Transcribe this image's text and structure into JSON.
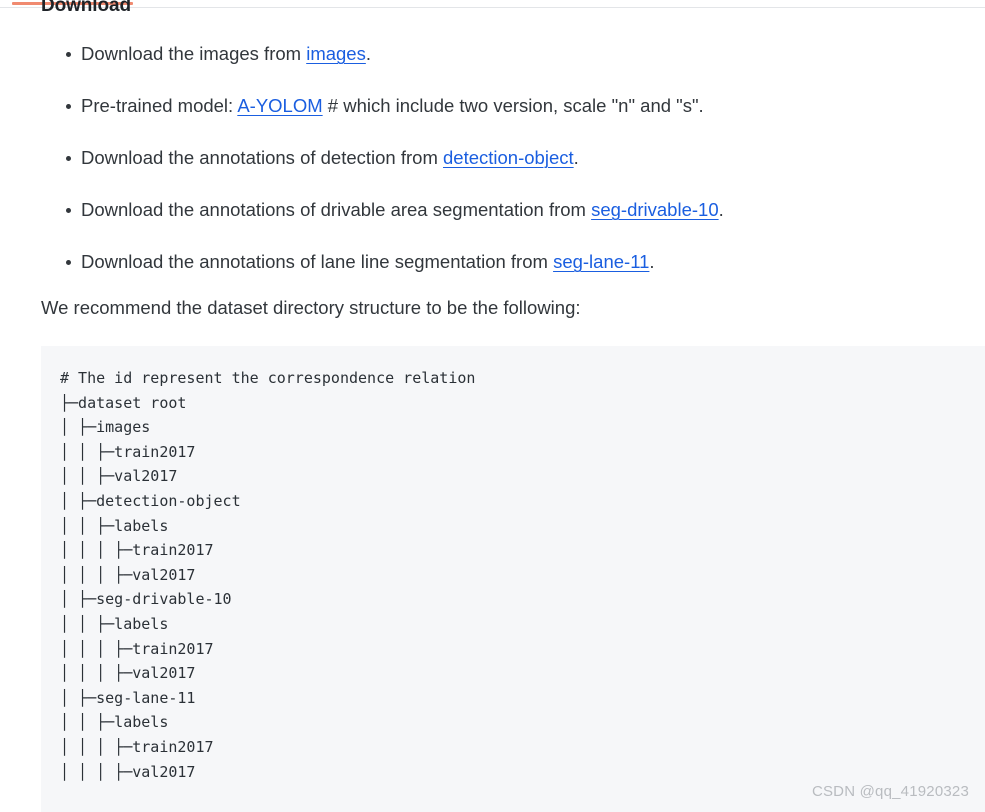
{
  "decorations": {
    "accent_color": "#f08a70",
    "rule_color": "#e3e5e8"
  },
  "heading": {
    "text": "Download"
  },
  "bullets": [
    {
      "pre": "Download the images from ",
      "link": "images",
      "post": "."
    },
    {
      "pre": "Pre-trained model: ",
      "link": "A-YOLOM",
      "post": " # which include two version, scale \"n\" and \"s\"."
    },
    {
      "pre": "Download the annotations of detection from ",
      "link": "detection-object",
      "post": "."
    },
    {
      "pre": "Download the annotations of drivable area segmentation from ",
      "link": "seg-drivable-10",
      "post": "."
    },
    {
      "pre": "Download the annotations of lane line segmentation from ",
      "link": "seg-lane-11",
      "post": "."
    }
  ],
  "paragraph": {
    "recommend": "We recommend the dataset directory structure to be the following:"
  },
  "code_block": {
    "language": "text",
    "background": "#f6f7f9",
    "lines": [
      "# The id represent the correspondence relation",
      "├─dataset root",
      "│ ├─images",
      "│ │ ├─train2017",
      "│ │ ├─val2017",
      "│ ├─detection-object",
      "│ │ ├─labels",
      "│ │ │ ├─train2017",
      "│ │ │ ├─val2017",
      "│ ├─seg-drivable-10",
      "│ │ ├─labels",
      "│ │ │ ├─train2017",
      "│ │ │ ├─val2017",
      "│ ├─seg-lane-11",
      "│ │ ├─labels",
      "│ │ │ ├─train2017",
      "│ │ │ ├─val2017"
    ],
    "text": "# The id represent the correspondence relation\n├─dataset root\n│ ├─images\n│ │ ├─train2017\n│ │ ├─val2017\n│ ├─detection-object\n│ │ ├─labels\n│ │ │ ├─train2017\n│ │ │ ├─val2017\n│ ├─seg-drivable-10\n│ │ ├─labels\n│ │ │ ├─train2017\n│ │ │ ├─val2017\n│ ├─seg-lane-11\n│ │ ├─labels\n│ │ │ ├─train2017\n│ │ │ ├─val2017"
  },
  "watermark": {
    "text": "CSDN @qq_41920323"
  }
}
